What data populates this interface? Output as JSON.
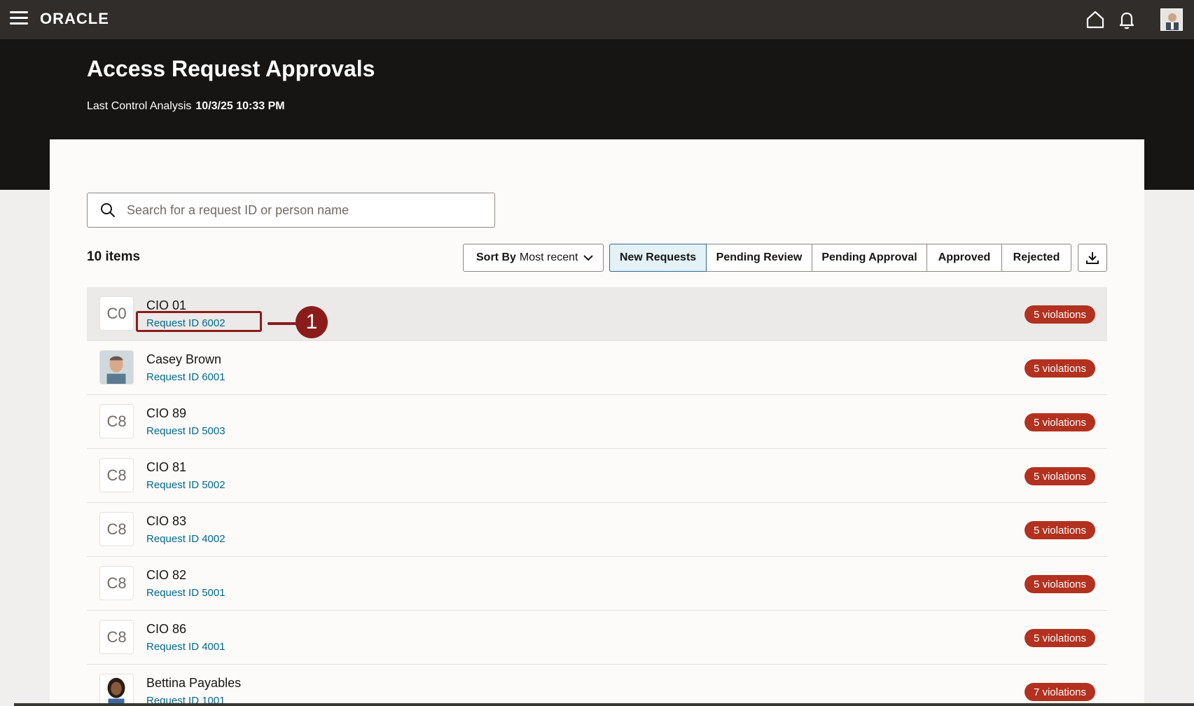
{
  "header": {
    "brand": "ORACLE",
    "menu_icon": "hamburger-menu-icon",
    "home_icon": "home-icon",
    "notifications_icon": "bell-icon"
  },
  "page": {
    "title": "Access Request Approvals",
    "analysis_label": "Last Control Analysis",
    "analysis_value": "10/3/25 10:33 PM"
  },
  "search": {
    "placeholder": "Search for a request ID or person name",
    "value": ""
  },
  "toolbar": {
    "count": "10 items",
    "sort_label": "Sort By",
    "sort_value": "Most recent",
    "filters": [
      "New Requests",
      "Pending Review",
      "Pending Approval",
      "Approved",
      "Rejected"
    ],
    "active_filter": "New Requests",
    "download_icon": "download-icon"
  },
  "requests": [
    {
      "initials": "C0",
      "name": "CIO 01",
      "request_id": "Request ID 6002",
      "violations": "5 violations"
    },
    {
      "initials": "",
      "name": "Casey Brown",
      "request_id": "Request ID 6001",
      "violations": "5 violations"
    },
    {
      "initials": "C8",
      "name": "CIO 89",
      "request_id": "Request ID 5003",
      "violations": "5 violations"
    },
    {
      "initials": "C8",
      "name": "CIO 81",
      "request_id": "Request ID 5002",
      "violations": "5 violations"
    },
    {
      "initials": "C8",
      "name": "CIO 83",
      "request_id": "Request ID 4002",
      "violations": "5 violations"
    },
    {
      "initials": "C8",
      "name": "CIO 82",
      "request_id": "Request ID 5001",
      "violations": "5 violations"
    },
    {
      "initials": "C8",
      "name": "CIO 86",
      "request_id": "Request ID 4001",
      "violations": "5 violations"
    },
    {
      "initials": "",
      "name": "Bettina Payables",
      "request_id": "Request ID 1001",
      "violations": "7 violations"
    }
  ],
  "annotation": {
    "number": "1"
  },
  "colors": {
    "topbar": "#312d2a",
    "hero": "#161513",
    "link": "#00688c",
    "badge": "#b3311f",
    "callout": "#8b1c1c",
    "active_filter_bg": "#e4f1f7"
  }
}
